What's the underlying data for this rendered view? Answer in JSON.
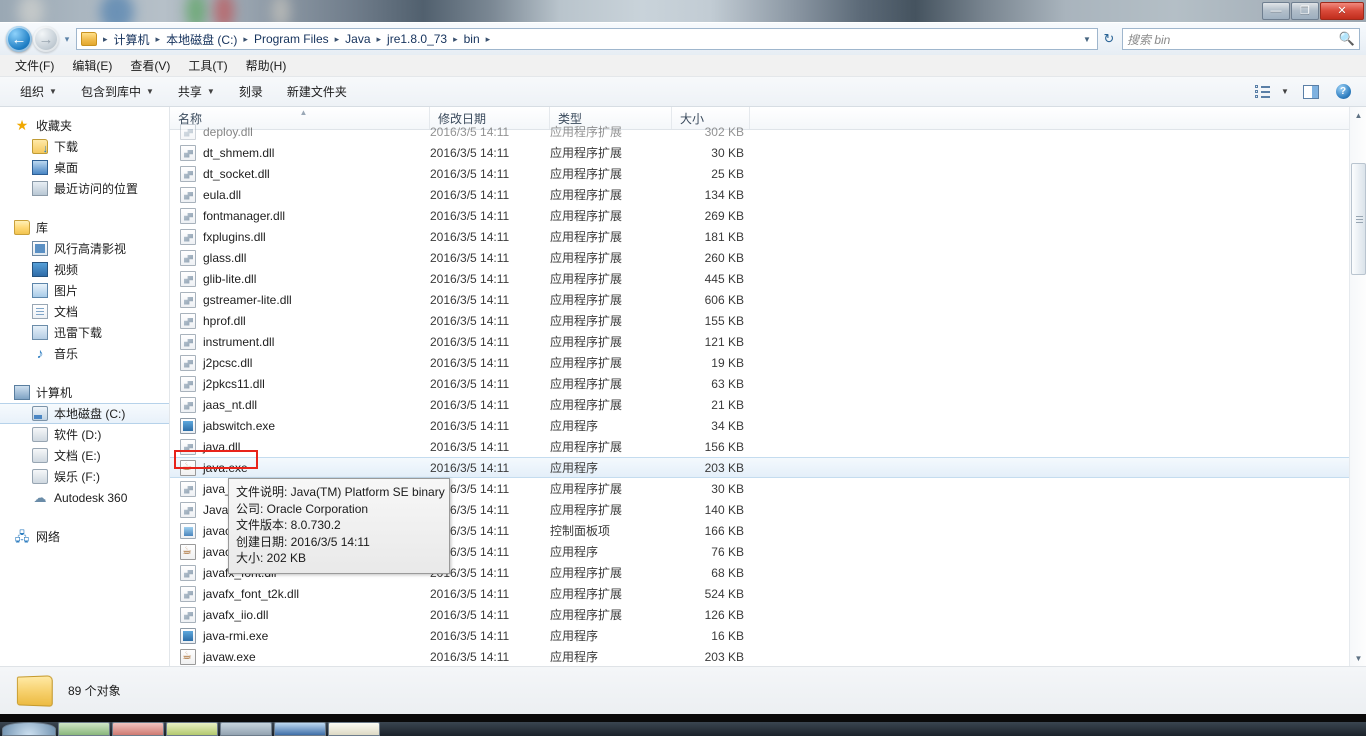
{
  "window": {
    "controls": {
      "minimize": "—",
      "maximize": "❐",
      "close": "✕"
    }
  },
  "addressbar": {
    "back_icon": "←",
    "forward_icon": "→",
    "history_caret": "▾",
    "folder_icon": "folder-icon",
    "crumbs": [
      "计算机",
      "本地磁盘 (C:)",
      "Program Files",
      "Java",
      "jre1.8.0_73",
      "bin"
    ],
    "separator": "▸",
    "dropdown_caret": "▼",
    "refresh_icon": "↻",
    "search_placeholder": "搜索 bin",
    "search_value": "",
    "search_icon": "🔍"
  },
  "menubar": {
    "items": [
      "文件(F)",
      "编辑(E)",
      "查看(V)",
      "工具(T)",
      "帮助(H)"
    ]
  },
  "toolbar": {
    "items": [
      {
        "label": "组织",
        "caret": "▼"
      },
      {
        "label": "包含到库中",
        "caret": "▼"
      },
      {
        "label": "共享",
        "caret": "▼"
      },
      {
        "label": "刻录",
        "caret": ""
      },
      {
        "label": "新建文件夹",
        "caret": ""
      }
    ],
    "view_caret": "▼",
    "icons": [
      "view-options-icon",
      "preview-pane-icon",
      "help-icon"
    ],
    "help_glyph": "?"
  },
  "navpane": {
    "sections": [
      {
        "root": {
          "label": "收藏夹",
          "icon": "star-icon"
        },
        "children": [
          {
            "label": "下载",
            "icon": "downloads-icon"
          },
          {
            "label": "桌面",
            "icon": "desktop-icon"
          },
          {
            "label": "最近访问的位置",
            "icon": "recent-places-icon"
          }
        ]
      },
      {
        "root": {
          "label": "库",
          "icon": "library-icon"
        },
        "children": [
          {
            "label": "风行高清影视",
            "icon": "media-library-icon"
          },
          {
            "label": "视频",
            "icon": "videos-icon"
          },
          {
            "label": "图片",
            "icon": "pictures-icon"
          },
          {
            "label": "文档",
            "icon": "documents-icon"
          },
          {
            "label": "迅雷下载",
            "icon": "thunder-download-icon"
          },
          {
            "label": "音乐",
            "icon": "music-icon"
          }
        ]
      },
      {
        "root": {
          "label": "计算机",
          "icon": "computer-icon"
        },
        "children": [
          {
            "label": "本地磁盘 (C:)",
            "icon": "system-drive-icon",
            "selected": true
          },
          {
            "label": "软件 (D:)",
            "icon": "drive-icon"
          },
          {
            "label": "文档 (E:)",
            "icon": "drive-icon"
          },
          {
            "label": "娱乐 (F:)",
            "icon": "drive-icon"
          },
          {
            "label": "Autodesk 360",
            "icon": "cloud-icon"
          }
        ]
      },
      {
        "root": {
          "label": "网络",
          "icon": "network-icon"
        },
        "children": []
      }
    ]
  },
  "filelist": {
    "columns": [
      "名称",
      "修改日期",
      "类型",
      "大小"
    ],
    "sort_indicator": "▲",
    "sort_column": "名称",
    "rows": [
      {
        "name": "deploy.dll",
        "icon": "dll-icon",
        "date": "2016/3/5 14:11",
        "type": "应用程序扩展",
        "size": "302 KB",
        "clipped": true
      },
      {
        "name": "dt_shmem.dll",
        "icon": "dll-icon",
        "date": "2016/3/5 14:11",
        "type": "应用程序扩展",
        "size": "30 KB"
      },
      {
        "name": "dt_socket.dll",
        "icon": "dll-icon",
        "date": "2016/3/5 14:11",
        "type": "应用程序扩展",
        "size": "25 KB"
      },
      {
        "name": "eula.dll",
        "icon": "dll-icon",
        "date": "2016/3/5 14:11",
        "type": "应用程序扩展",
        "size": "134 KB"
      },
      {
        "name": "fontmanager.dll",
        "icon": "dll-icon",
        "date": "2016/3/5 14:11",
        "type": "应用程序扩展",
        "size": "269 KB"
      },
      {
        "name": "fxplugins.dll",
        "icon": "dll-icon",
        "date": "2016/3/5 14:11",
        "type": "应用程序扩展",
        "size": "181 KB"
      },
      {
        "name": "glass.dll",
        "icon": "dll-icon",
        "date": "2016/3/5 14:11",
        "type": "应用程序扩展",
        "size": "260 KB"
      },
      {
        "name": "glib-lite.dll",
        "icon": "dll-icon",
        "date": "2016/3/5 14:11",
        "type": "应用程序扩展",
        "size": "445 KB"
      },
      {
        "name": "gstreamer-lite.dll",
        "icon": "dll-icon",
        "date": "2016/3/5 14:11",
        "type": "应用程序扩展",
        "size": "606 KB"
      },
      {
        "name": "hprof.dll",
        "icon": "dll-icon",
        "date": "2016/3/5 14:11",
        "type": "应用程序扩展",
        "size": "155 KB"
      },
      {
        "name": "instrument.dll",
        "icon": "dll-icon",
        "date": "2016/3/5 14:11",
        "type": "应用程序扩展",
        "size": "121 KB"
      },
      {
        "name": "j2pcsc.dll",
        "icon": "dll-icon",
        "date": "2016/3/5 14:11",
        "type": "应用程序扩展",
        "size": "19 KB"
      },
      {
        "name": "j2pkcs11.dll",
        "icon": "dll-icon",
        "date": "2016/3/5 14:11",
        "type": "应用程序扩展",
        "size": "63 KB"
      },
      {
        "name": "jaas_nt.dll",
        "icon": "dll-icon",
        "date": "2016/3/5 14:11",
        "type": "应用程序扩展",
        "size": "21 KB"
      },
      {
        "name": "jabswitch.exe",
        "icon": "exe-icon",
        "date": "2016/3/5 14:11",
        "type": "应用程序",
        "size": "34 KB"
      },
      {
        "name": "java.dll",
        "icon": "dll-icon",
        "date": "2016/3/5 14:11",
        "type": "应用程序扩展",
        "size": "156 KB"
      },
      {
        "name": "java.exe",
        "icon": "java-icon",
        "date": "2016/3/5 14:11",
        "type": "应用程序",
        "size": "203 KB",
        "selected": true,
        "annotated": true
      },
      {
        "name": "java_crw_demo.dll",
        "icon": "dll-icon",
        "date": "2016/3/5 14:11",
        "type": "应用程序扩展",
        "size": "30 KB"
      },
      {
        "name": "JavaAccessBridge.dll",
        "icon": "dll-icon",
        "date": "2016/3/5 14:11",
        "type": "应用程序扩展",
        "size": "140 KB"
      },
      {
        "name": "javacpl.cpl",
        "icon": "cpl-icon",
        "date": "2016/3/5 14:11",
        "type": "控制面板项",
        "size": "166 KB"
      },
      {
        "name": "javacpl.exe",
        "icon": "java-icon",
        "date": "2016/3/5 14:11",
        "type": "应用程序",
        "size": "76 KB"
      },
      {
        "name": "javafx_font.dll",
        "icon": "dll-icon",
        "date": "2016/3/5 14:11",
        "type": "应用程序扩展",
        "size": "68 KB"
      },
      {
        "name": "javafx_font_t2k.dll",
        "icon": "dll-icon",
        "date": "2016/3/5 14:11",
        "type": "应用程序扩展",
        "size": "524 KB"
      },
      {
        "name": "javafx_iio.dll",
        "icon": "dll-icon",
        "date": "2016/3/5 14:11",
        "type": "应用程序扩展",
        "size": "126 KB"
      },
      {
        "name": "java-rmi.exe",
        "icon": "exe-icon",
        "date": "2016/3/5 14:11",
        "type": "应用程序",
        "size": "16 KB"
      },
      {
        "name": "javaw.exe",
        "icon": "java-icon",
        "date": "2016/3/5 14:11",
        "type": "应用程序",
        "size": "203 KB"
      }
    ]
  },
  "tooltip": {
    "lines": [
      "文件说明: Java(TM) Platform SE binary",
      "公司: Oracle Corporation",
      "文件版本: 8.0.730.2",
      "创建日期: 2016/3/5 14:11",
      "大小: 202 KB"
    ]
  },
  "scrollbar": {
    "up_arrow": "▲",
    "down_arrow": "▼"
  },
  "statusbar": {
    "folder_icon": "folder-icon",
    "text": "89 个对象"
  },
  "colors": {
    "selection": "#e4eff9",
    "annotation": "#e8231a",
    "accent": "#2a6496",
    "titlebar_close": "#c02d1c"
  }
}
